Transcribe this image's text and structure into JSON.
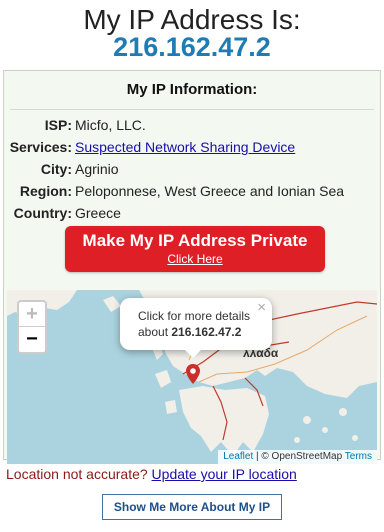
{
  "header": {
    "title": "My IP Address Is:",
    "ip": "216.162.47.2"
  },
  "panel": {
    "heading": "My IP Information:",
    "rows": [
      {
        "label": "ISP:",
        "value": "Micfo, LLC."
      },
      {
        "label": "Services:",
        "value": "Suspected Network Sharing Device"
      },
      {
        "label": "City:",
        "value": "Agrinio"
      },
      {
        "label": "Region:",
        "value": "Peloponnese, West Greece and Ionian Sea"
      },
      {
        "label": "Country:",
        "value": "Greece"
      }
    ],
    "cta": {
      "main": "Make My IP Address Private",
      "sub": "Click Here"
    }
  },
  "map": {
    "zoom_in": "+",
    "zoom_out": "−",
    "popup": {
      "line1": "Click for more details",
      "line2_prefix": "about",
      "ip": "216.162.47.2",
      "close": "×"
    },
    "country_label": "λλάδα",
    "attribution": {
      "leaflet": "Leaflet",
      "osm": "| © OpenStreetMap",
      "terms": "Terms"
    },
    "colors": {
      "sea": "#aad3df",
      "land": "#f2efe9",
      "border": "#c03b2b",
      "marker": "#c9302c"
    }
  },
  "accuracy": {
    "question": "Location not accurate?",
    "link": "Update your IP location"
  },
  "more_button": "Show Me More About My IP"
}
